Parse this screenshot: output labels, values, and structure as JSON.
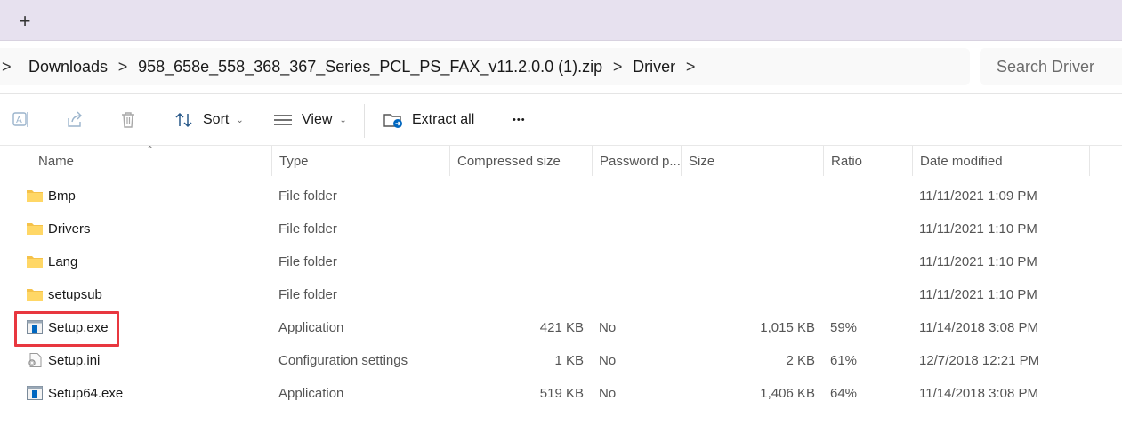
{
  "tabs": {
    "new_tab_label": "+"
  },
  "address": {
    "crumbs": [
      "Downloads",
      "958_658e_558_368_367_Series_PCL_PS_FAX_v11.2.0.0 (1).zip",
      "Driver"
    ],
    "separator": ">",
    "search_placeholder": "Search Driver"
  },
  "toolbar": {
    "sort_label": "Sort",
    "view_label": "View",
    "extract_label": "Extract all",
    "more_label": "•••"
  },
  "columns": {
    "name": "Name",
    "type": "Type",
    "compressed": "Compressed size",
    "password": "Password p...",
    "size": "Size",
    "ratio": "Ratio",
    "date": "Date modified"
  },
  "rows": [
    {
      "name": "Bmp",
      "type": "File folder",
      "compressed": "",
      "password": "",
      "size": "",
      "ratio": "",
      "date": "11/11/2021 1:09 PM",
      "icon": "folder-icon"
    },
    {
      "name": "Drivers",
      "type": "File folder",
      "compressed": "",
      "password": "",
      "size": "",
      "ratio": "",
      "date": "11/11/2021 1:10 PM",
      "icon": "folder-icon"
    },
    {
      "name": "Lang",
      "type": "File folder",
      "compressed": "",
      "password": "",
      "size": "",
      "ratio": "",
      "date": "11/11/2021 1:10 PM",
      "icon": "folder-icon"
    },
    {
      "name": "setupsub",
      "type": "File folder",
      "compressed": "",
      "password": "",
      "size": "",
      "ratio": "",
      "date": "11/11/2021 1:10 PM",
      "icon": "folder-icon"
    },
    {
      "name": "Setup.exe",
      "type": "Application",
      "compressed": "421 KB",
      "password": "No",
      "size": "1,015 KB",
      "ratio": "59%",
      "date": "11/14/2018 3:08 PM",
      "icon": "application-icon"
    },
    {
      "name": "Setup.ini",
      "type": "Configuration settings",
      "compressed": "1 KB",
      "password": "No",
      "size": "2 KB",
      "ratio": "61%",
      "date": "12/7/2018 12:21 PM",
      "icon": "config-file-icon"
    },
    {
      "name": "Setup64.exe",
      "type": "Application",
      "compressed": "519 KB",
      "password": "No",
      "size": "1,406 KB",
      "ratio": "64%",
      "date": "11/14/2018 3:08 PM",
      "icon": "application-icon"
    }
  ],
  "colors": {
    "highlight": "#e8373f",
    "folder": "#f5c24a",
    "accent": "#0067c0"
  }
}
